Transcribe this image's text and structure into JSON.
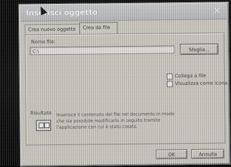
{
  "window": {
    "title": "Inserisci oggetto",
    "close_glyph": "×"
  },
  "tabs": [
    {
      "label": "Crea nuovo oggetto",
      "active": false
    },
    {
      "label": "Crea da file",
      "active": true
    }
  ],
  "file": {
    "label": "Nome file:",
    "value": "C:\\",
    "browse_label": "Sfoglia..."
  },
  "options": [
    {
      "label": "Collega a file",
      "checked": false
    },
    {
      "label": "Visualizza come icona",
      "checked": false
    }
  ],
  "result": {
    "label": "Risultato",
    "icon": "object-icon",
    "lines": [
      "Inserisce il contenuto del file nel documento in modo",
      "che sia possibile modificarlo in seguito tramite",
      "l'applicazione con cui è stato creato."
    ]
  },
  "buttons": {
    "ok_label": "OK",
    "cancel_label": "Annulla"
  }
}
